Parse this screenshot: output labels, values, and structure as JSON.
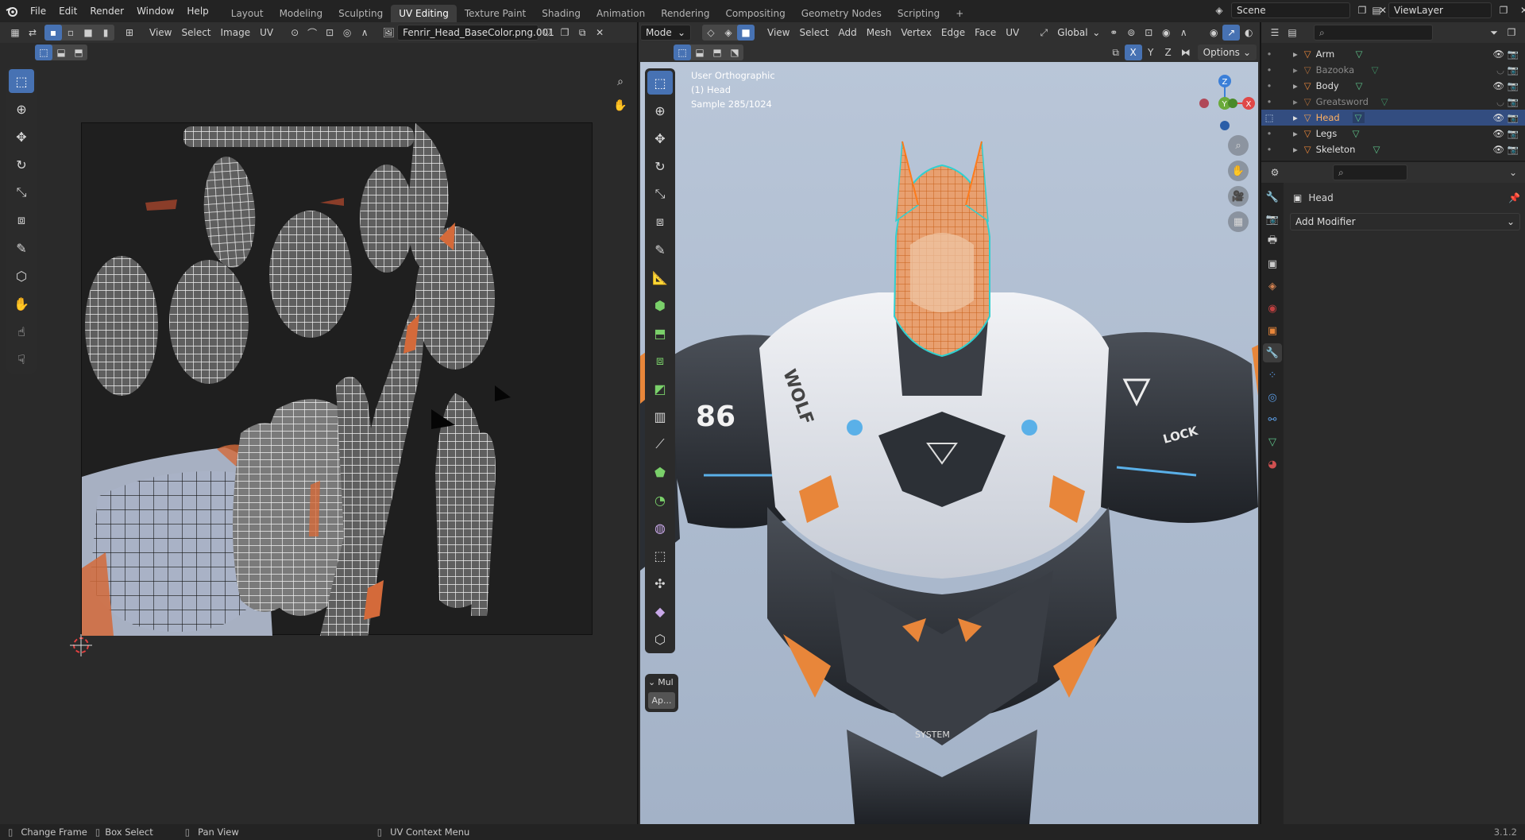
{
  "topbar": {
    "menus": [
      "File",
      "Edit",
      "Render",
      "Window",
      "Help"
    ],
    "workspaces": [
      "Layout",
      "Modeling",
      "Sculpting",
      "UV Editing",
      "Texture Paint",
      "Shading",
      "Animation",
      "Rendering",
      "Compositing",
      "Geometry Nodes",
      "Scripting"
    ],
    "active_workspace": "UV Editing",
    "add_tab": "+",
    "scene_name": "Scene",
    "view_layer": "ViewLayer"
  },
  "uv_editor": {
    "menus": [
      "View",
      "Select",
      "Image",
      "UV"
    ],
    "image_name": "Fenrir_Head_BaseColor.png.001"
  },
  "viewport": {
    "mode": "Mode",
    "menus": [
      "View",
      "Select",
      "Add",
      "Mesh",
      "Vertex",
      "Edge",
      "Face",
      "UV"
    ],
    "transform_orientation": "Global",
    "axes": [
      "X",
      "Y",
      "Z"
    ],
    "options": "Options",
    "overlay_lines": [
      "User Orthographic",
      "(1) Head",
      "Sample 285/1024"
    ],
    "gizmo_labels": {
      "z": "Z",
      "x": "X",
      "y": "Y"
    },
    "last_op_title": "Mul",
    "last_op_button": "Ap..."
  },
  "outliner": {
    "search_placeholder": "",
    "items": [
      {
        "name": "Arm",
        "selected": false,
        "dim": false
      },
      {
        "name": "Bazooka",
        "selected": false,
        "dim": true
      },
      {
        "name": "Body",
        "selected": false,
        "dim": false
      },
      {
        "name": "Greatsword",
        "selected": false,
        "dim": true
      },
      {
        "name": "Head",
        "selected": true,
        "dim": false
      },
      {
        "name": "Legs",
        "selected": false,
        "dim": false
      },
      {
        "name": "Skeleton",
        "selected": false,
        "dim": false
      }
    ]
  },
  "properties": {
    "object_name": "Head",
    "add_modifier": "Add Modifier"
  },
  "statusbar": {
    "items": [
      "Change Frame",
      "Box Select",
      "Pan View",
      "UV Context Menu"
    ],
    "version": "3.1.2"
  },
  "colors": {
    "accent": "#4772b3",
    "selected_row": "#334d80",
    "orange": "#e08a3c",
    "viewport_bg": "#aebcd0",
    "uv_bg": "#1f1f1f"
  }
}
